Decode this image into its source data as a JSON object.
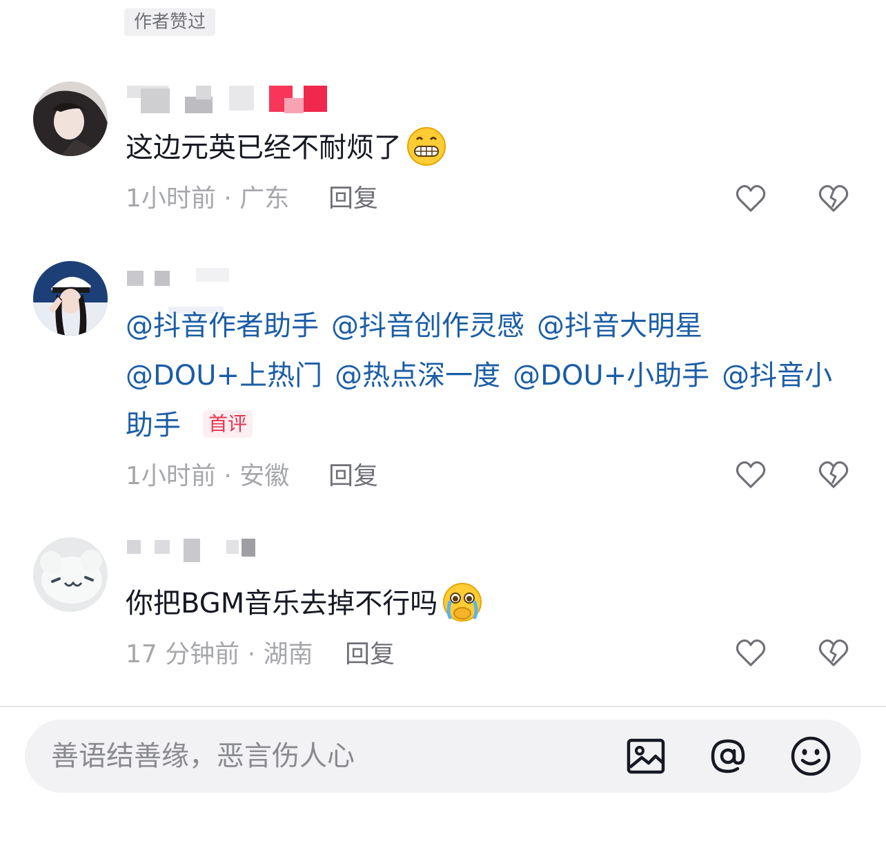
{
  "author_liked_tag": "作者赞过",
  "comments": [
    {
      "text": "这边元英已经不耐烦了",
      "emoji": "grinning-face-emoji",
      "meta": "1小时前 · 广东",
      "reply": "回复"
    },
    {
      "mentions": [
        "@抖音作者助手",
        "@抖音创作灵感",
        "@抖音大明星",
        "@DOU+上热门",
        "@热点深一度",
        "@DOU+小助手",
        "@抖音小助手"
      ],
      "badge": "首评",
      "meta": "1小时前 · 安徽",
      "reply": "回复"
    },
    {
      "text": "你把BGM音乐去掉不行吗",
      "emoji": "crying-face-emoji",
      "meta": "17 分钟前 · 湖南",
      "reply": "回复"
    }
  ],
  "input": {
    "placeholder": "善语结善缘，恶言伤人心",
    "icons": [
      "image-icon",
      "at-icon",
      "emoji-icon"
    ]
  },
  "colors": {
    "mention": "#1b5da5",
    "badge_text": "#e8334d",
    "badge_bg": "#fdeff1",
    "meta": "#a6a7ab"
  }
}
